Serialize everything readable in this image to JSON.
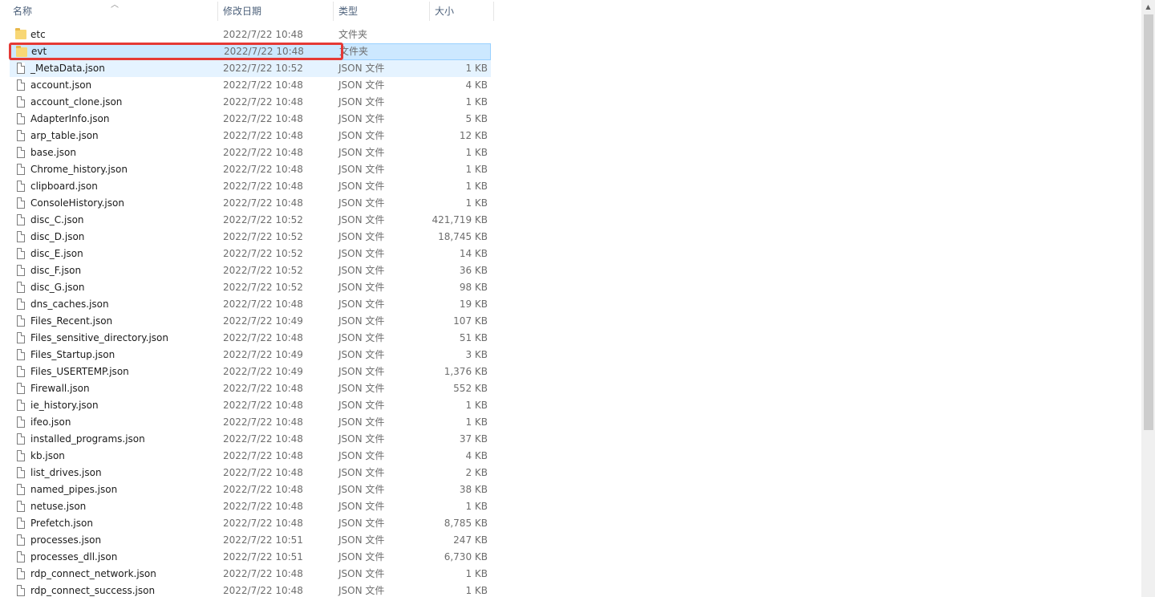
{
  "columns": {
    "name": "名称",
    "date": "修改日期",
    "type": "类型",
    "size": "大小"
  },
  "rows": [
    {
      "name": "etc",
      "date": "2022/7/22 10:48",
      "type": "文件夹",
      "size": "",
      "icon": "folder-icon"
    },
    {
      "name": "evt",
      "date": "2022/7/22 10:48",
      "type": "文件夹",
      "size": "",
      "icon": "folder-icon",
      "selected": true
    },
    {
      "name": "_MetaData.json",
      "date": "2022/7/22 10:52",
      "type": "JSON 文件",
      "size": "1 KB",
      "icon": "file-icon",
      "hover": true
    },
    {
      "name": "account.json",
      "date": "2022/7/22 10:48",
      "type": "JSON 文件",
      "size": "4 KB",
      "icon": "file-icon"
    },
    {
      "name": "account_clone.json",
      "date": "2022/7/22 10:48",
      "type": "JSON 文件",
      "size": "1 KB",
      "icon": "file-icon"
    },
    {
      "name": "AdapterInfo.json",
      "date": "2022/7/22 10:48",
      "type": "JSON 文件",
      "size": "5 KB",
      "icon": "file-icon"
    },
    {
      "name": "arp_table.json",
      "date": "2022/7/22 10:48",
      "type": "JSON 文件",
      "size": "12 KB",
      "icon": "file-icon"
    },
    {
      "name": "base.json",
      "date": "2022/7/22 10:48",
      "type": "JSON 文件",
      "size": "1 KB",
      "icon": "file-icon"
    },
    {
      "name": "Chrome_history.json",
      "date": "2022/7/22 10:48",
      "type": "JSON 文件",
      "size": "1 KB",
      "icon": "file-icon"
    },
    {
      "name": "clipboard.json",
      "date": "2022/7/22 10:48",
      "type": "JSON 文件",
      "size": "1 KB",
      "icon": "file-icon"
    },
    {
      "name": "ConsoleHistory.json",
      "date": "2022/7/22 10:48",
      "type": "JSON 文件",
      "size": "1 KB",
      "icon": "file-icon"
    },
    {
      "name": "disc_C.json",
      "date": "2022/7/22 10:52",
      "type": "JSON 文件",
      "size": "421,719 KB",
      "icon": "file-icon"
    },
    {
      "name": "disc_D.json",
      "date": "2022/7/22 10:52",
      "type": "JSON 文件",
      "size": "18,745 KB",
      "icon": "file-icon"
    },
    {
      "name": "disc_E.json",
      "date": "2022/7/22 10:52",
      "type": "JSON 文件",
      "size": "14 KB",
      "icon": "file-icon"
    },
    {
      "name": "disc_F.json",
      "date": "2022/7/22 10:52",
      "type": "JSON 文件",
      "size": "36 KB",
      "icon": "file-icon"
    },
    {
      "name": "disc_G.json",
      "date": "2022/7/22 10:52",
      "type": "JSON 文件",
      "size": "98 KB",
      "icon": "file-icon"
    },
    {
      "name": "dns_caches.json",
      "date": "2022/7/22 10:48",
      "type": "JSON 文件",
      "size": "19 KB",
      "icon": "file-icon"
    },
    {
      "name": "Files_Recent.json",
      "date": "2022/7/22 10:49",
      "type": "JSON 文件",
      "size": "107 KB",
      "icon": "file-icon"
    },
    {
      "name": "Files_sensitive_directory.json",
      "date": "2022/7/22 10:48",
      "type": "JSON 文件",
      "size": "51 KB",
      "icon": "file-icon"
    },
    {
      "name": "Files_Startup.json",
      "date": "2022/7/22 10:49",
      "type": "JSON 文件",
      "size": "3 KB",
      "icon": "file-icon"
    },
    {
      "name": "Files_USERTEMP.json",
      "date": "2022/7/22 10:49",
      "type": "JSON 文件",
      "size": "1,376 KB",
      "icon": "file-icon"
    },
    {
      "name": "Firewall.json",
      "date": "2022/7/22 10:48",
      "type": "JSON 文件",
      "size": "552 KB",
      "icon": "file-icon"
    },
    {
      "name": "ie_history.json",
      "date": "2022/7/22 10:48",
      "type": "JSON 文件",
      "size": "1 KB",
      "icon": "file-icon"
    },
    {
      "name": "ifeo.json",
      "date": "2022/7/22 10:48",
      "type": "JSON 文件",
      "size": "1 KB",
      "icon": "file-icon"
    },
    {
      "name": "installed_programs.json",
      "date": "2022/7/22 10:48",
      "type": "JSON 文件",
      "size": "37 KB",
      "icon": "file-icon"
    },
    {
      "name": "kb.json",
      "date": "2022/7/22 10:48",
      "type": "JSON 文件",
      "size": "4 KB",
      "icon": "file-icon"
    },
    {
      "name": "list_drives.json",
      "date": "2022/7/22 10:48",
      "type": "JSON 文件",
      "size": "2 KB",
      "icon": "file-icon"
    },
    {
      "name": "named_pipes.json",
      "date": "2022/7/22 10:48",
      "type": "JSON 文件",
      "size": "38 KB",
      "icon": "file-icon"
    },
    {
      "name": "netuse.json",
      "date": "2022/7/22 10:48",
      "type": "JSON 文件",
      "size": "1 KB",
      "icon": "file-icon"
    },
    {
      "name": "Prefetch.json",
      "date": "2022/7/22 10:48",
      "type": "JSON 文件",
      "size": "8,785 KB",
      "icon": "file-icon"
    },
    {
      "name": "processes.json",
      "date": "2022/7/22 10:51",
      "type": "JSON 文件",
      "size": "247 KB",
      "icon": "file-icon"
    },
    {
      "name": "processes_dll.json",
      "date": "2022/7/22 10:51",
      "type": "JSON 文件",
      "size": "6,730 KB",
      "icon": "file-icon"
    },
    {
      "name": "rdp_connect_network.json",
      "date": "2022/7/22 10:48",
      "type": "JSON 文件",
      "size": "1 KB",
      "icon": "file-icon"
    },
    {
      "name": "rdp_connect_success.json",
      "date": "2022/7/22 10:48",
      "type": "JSON 文件",
      "size": "1 KB",
      "icon": "file-icon"
    }
  ]
}
